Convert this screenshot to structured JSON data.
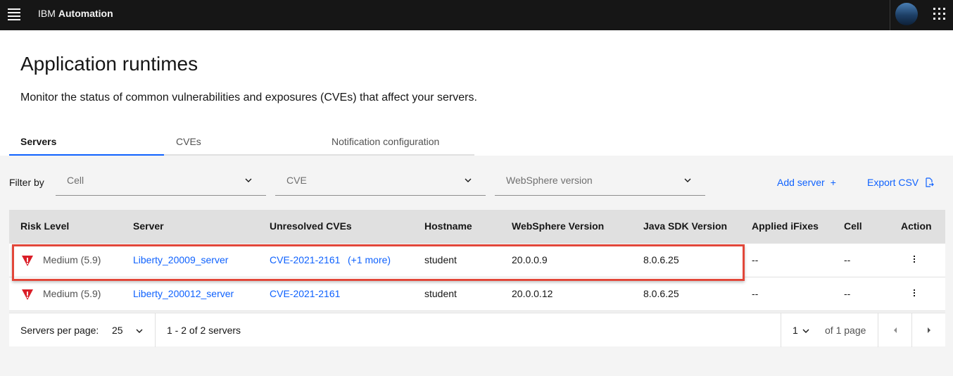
{
  "header": {
    "brand_prefix": "IBM",
    "brand_name": "Automation"
  },
  "page": {
    "title": "Application runtimes",
    "description": "Monitor the status of common vulnerabilities and exposures (CVEs) that affect your servers."
  },
  "tabs": [
    {
      "label": "Servers",
      "active": true
    },
    {
      "label": "CVEs",
      "active": false
    },
    {
      "label": "Notification configuration",
      "active": false
    }
  ],
  "filters": {
    "label": "Filter by",
    "cell_placeholder": "Cell",
    "cve_placeholder": "CVE",
    "websphere_placeholder": "WebSphere version"
  },
  "actions": {
    "add_server": "Add server",
    "add_icon": "plus-icon",
    "export_csv": "Export CSV",
    "export_icon": "export-icon"
  },
  "table": {
    "columns": [
      "Risk Level",
      "Server",
      "Unresolved CVEs",
      "Hostname",
      "WebSphere Version",
      "Java SDK Version",
      "Applied iFixes",
      "Cell",
      "Action"
    ],
    "rows": [
      {
        "risk": "Medium (5.9)",
        "server": "Liberty_20009_server",
        "cves": "CVE-2021-2161",
        "cves_more": "(+1 more)",
        "hostname": "student",
        "websphere": "20.0.0.9",
        "java_sdk": "8.0.6.25",
        "ifixes": "--",
        "cell": "--"
      },
      {
        "risk": "Medium (5.9)",
        "server": "Liberty_200012_server",
        "cves": "CVE-2021-2161",
        "cves_more": "",
        "hostname": "student",
        "websphere": "20.0.0.12",
        "java_sdk": "8.0.6.25",
        "ifixes": "--",
        "cell": "--"
      }
    ]
  },
  "pagination": {
    "per_page_label": "Servers per page:",
    "per_page_value": "25",
    "range_text": "1 - 2 of 2 servers",
    "page_value": "1",
    "of_pages": "of 1 page"
  },
  "colors": {
    "accent": "#0f62fe",
    "risk_medium": "#da1e28",
    "highlight_box": "#e2473a",
    "topbar": "#161616"
  }
}
